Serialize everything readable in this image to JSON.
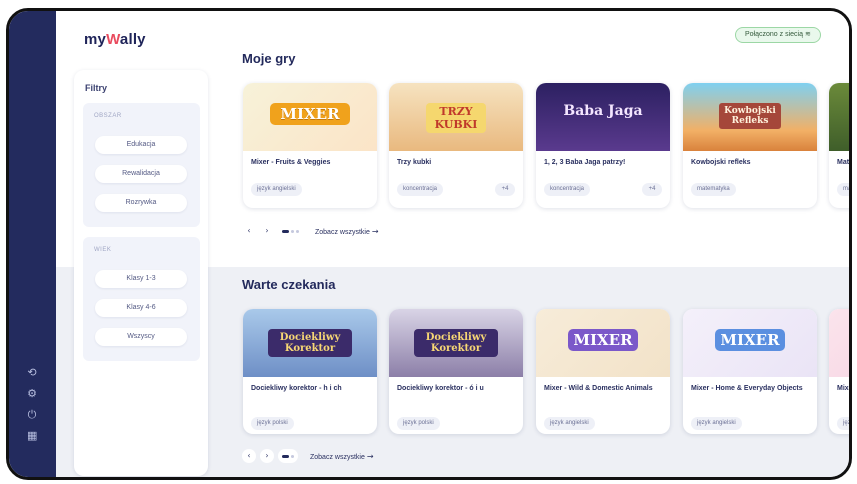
{
  "app": {
    "logo_prefix": "my",
    "logo_w": "W",
    "logo_suffix": "ally",
    "connection_status": "Połączono z siecią",
    "connection_icon": "wifi-icon"
  },
  "filters": {
    "title": "Filtry",
    "groups": [
      {
        "label": "OBSZAR",
        "options": [
          "Edukacja",
          "Rewalidacja",
          "Rozrywka"
        ]
      },
      {
        "label": "WIEK",
        "options": [
          "Klasy 1-3",
          "Klasy 4-6",
          "Wszyscy"
        ]
      }
    ]
  },
  "sidebar_icons": [
    "refresh-icon",
    "settings-icon",
    "power-icon",
    "calculator-icon"
  ],
  "sections": [
    {
      "title": "Moje gry",
      "see_all": "Zobacz wszystkie",
      "cards": [
        {
          "title": "Mixer - Fruits & Veggies",
          "thumb_text": "MIXER",
          "tag": "język angielski",
          "more": ""
        },
        {
          "title": "Trzy kubki",
          "thumb_text": "TRZY KUBKI",
          "tag": "koncentracja",
          "more": "+4"
        },
        {
          "title": "1, 2, 3 Baba Jaga patrzy!",
          "thumb_text": "Baba Jaga",
          "tag": "koncentracja",
          "more": "+4"
        },
        {
          "title": "Kowbojski refleks",
          "thumb_text": "Kowbojski Refleks",
          "tag": "matematyka",
          "more": ""
        },
        {
          "title": "Mate",
          "thumb_text": "",
          "tag": "mat",
          "more": ""
        }
      ]
    },
    {
      "title": "Warte czekania",
      "see_all": "Zobacz wszystkie",
      "cards": [
        {
          "title": "Dociekliwy korektor - h i ch",
          "thumb_text": "Dociekliwy Korektor",
          "tag": "język polski",
          "more": ""
        },
        {
          "title": "Dociekliwy korektor - ó i u",
          "thumb_text": "Dociekliwy Korektor",
          "tag": "język polski",
          "more": ""
        },
        {
          "title": "Mixer - Wild & Domestic Animals",
          "thumb_text": "MIXER",
          "tag": "język angielski",
          "more": ""
        },
        {
          "title": "Mixer - Home & Everyday Objects",
          "thumb_text": "MIXER",
          "tag": "język angielski",
          "more": ""
        },
        {
          "title": "Mixe Acce",
          "thumb_text": "",
          "tag": "język",
          "more": ""
        }
      ]
    }
  ],
  "colors": {
    "rail": "#232b5e",
    "accent_red": "#e94b5e",
    "status_green": "#e9f8ec"
  }
}
